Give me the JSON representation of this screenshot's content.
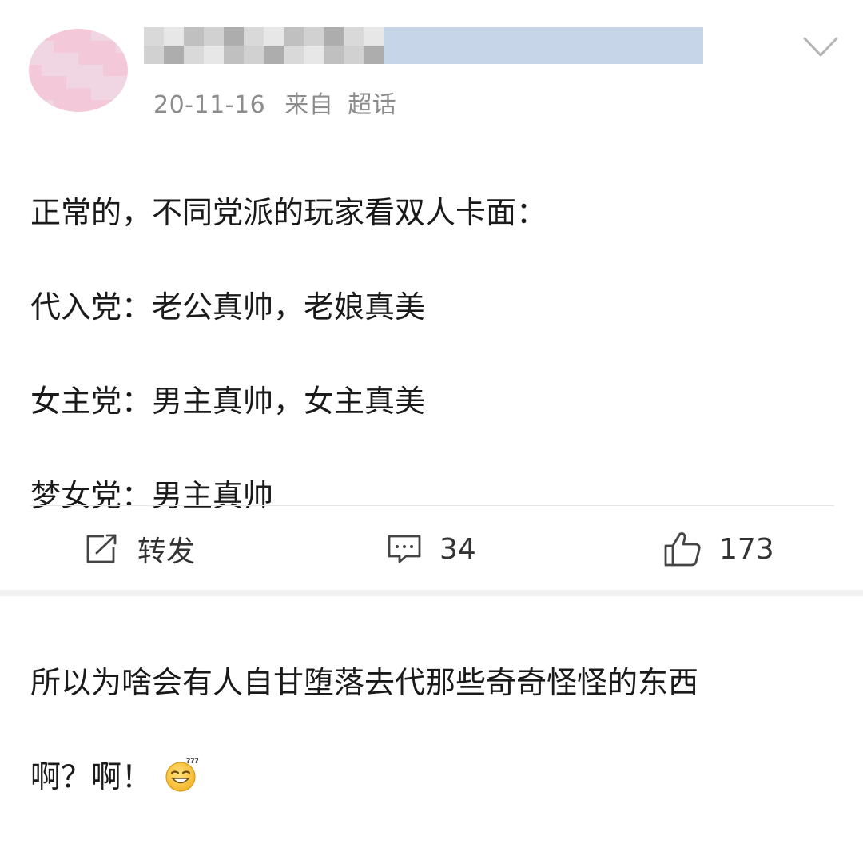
{
  "post": {
    "date": "20-11-16",
    "source_prefix": "来自",
    "source": "超话",
    "lines": [
      "正常的，不同党派的玩家看双人卡面：",
      "代入党：老公真帅，老娘真美",
      "女主党：男主真帅，女主真美",
      "梦女党：男主真帅",
      "",
      "所以为啥会有人自甘堕落去代那些奇奇怪怪的东西",
      "啊？啊！"
    ],
    "emoji": "sweat-grin-emoji"
  },
  "actions": {
    "repost_label": "转发",
    "comment_count": "34",
    "like_count": "173"
  },
  "icons": {
    "menu": "chevron-down-icon",
    "repost": "share-out-icon",
    "comment": "comment-bubble-icon",
    "like": "thumbs-up-icon"
  },
  "colors": {
    "meta_text": "#8c8c8c",
    "body_text": "#1a1a1a",
    "divider": "#e6e6e6"
  }
}
